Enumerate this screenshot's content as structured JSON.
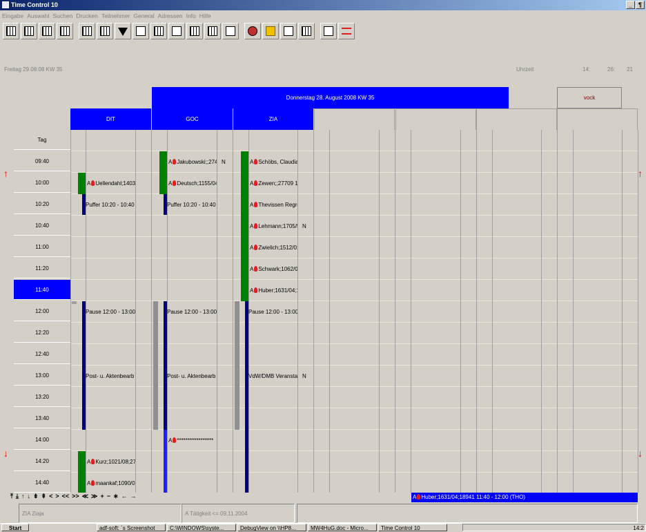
{
  "window": {
    "title": "Time Control 10",
    "min": "_",
    "restore": "¶"
  },
  "menu": [
    "Eingabe",
    "Auswahl",
    "Suchen",
    "Drucken",
    "Teilnehmer",
    "General",
    "Adressen",
    "Info",
    "Hilfe"
  ],
  "toolbar": {
    "icons": [
      "grid-week-icon",
      "grid-month-icon",
      "grid-day-icon",
      "grid-list-icon",
      "columns-icon",
      "columns-split-icon",
      "filter-icon",
      "window-icon",
      "calculator-icon",
      "camera-icon",
      "priority-icon",
      "planner-icon",
      "stamp-icon",
      "person-icon",
      "lock-icon",
      "dialog-icon",
      "document-icon",
      "transfer-icon",
      "red-list-icon"
    ]
  },
  "datebar": {
    "date": "Freitag 29.08.08 KW 35",
    "time_label": "Uhrzeit",
    "hh": "14:",
    "mm": "26:",
    "ss": "21"
  },
  "day_header": "Donnerstag 28. August 2008 KW 35",
  "user_tab": "vock",
  "rooms": [
    "DIT",
    "GOC",
    "ZIA"
  ],
  "times": [
    "Tag",
    "09:40",
    "10:00",
    "10:20",
    "10:40",
    "11:00",
    "11:20",
    "11:40",
    "12:00",
    "12:20",
    "12:40",
    "13:00",
    "13:20",
    "13:40",
    "14:00",
    "14:20",
    "14:40"
  ],
  "selected_time": "11:40",
  "entries": {
    "dit": [
      "Uellendahl;1403/",
      "Puffer 10:20 - 10:40",
      "Pause 12:00 - 13:00",
      "Post- u. Aktenbearb",
      "Kurz;1021/08;27",
      "maankaf;1090/0"
    ],
    "goc": [
      "Jakubowski;;274",
      "Deutsch;1155/04",
      "Puffer 10:20 - 10:40",
      "Pause 12:00 - 13:00",
      "Post- u. Aktenbearb",
      "*****************"
    ],
    "zia": [
      "Schöbs, Claudia",
      "Zewen;;27709 1",
      "Thevissen Regre",
      "Lehmann;1705/5",
      "Zwielich;1512/0:",
      "Schwark;1062/0",
      "Huber;1631/04;1",
      "Pause 12:00 - 13:00",
      "VdW/DMB Veransta"
    ],
    "n": "N",
    "a": "A"
  },
  "nav_buttons": [
    "⤒",
    "⤓",
    "↑",
    "↓",
    "⇟",
    "⇞",
    "<",
    ">",
    "<<",
    ">>",
    "≪",
    "≫",
    "+",
    "−",
    "∗",
    "←",
    "→"
  ],
  "status": {
    "selection": "Huber;1631/04;18941 11:40 - 12:00 (THO)",
    "person": "ZIA Ziaja",
    "activity": "A Tätigkeit <= 09.11.2004"
  },
  "taskbar": {
    "start": "Start",
    "tasks": [
      "adf-soft: ´s Screenshot",
      "C:\\WINDOWS\\syste...",
      "DebugView on \\\\HP8...",
      "MW4HuG.doc - Micro...",
      "Time Control 10"
    ],
    "clock": "14:2"
  },
  "colors": {
    "accent": "#0000ff",
    "green": "#008000",
    "navy": "#000080",
    "alert": "#e00000"
  }
}
